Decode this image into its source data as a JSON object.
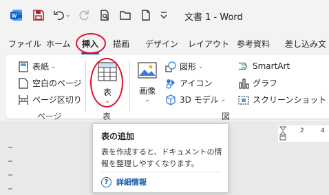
{
  "titlebar": {
    "word_icon_letter": "W",
    "doc_title": "文書 1  -  Word"
  },
  "tabs": [
    {
      "label": "ファイル"
    },
    {
      "label": "ホーム"
    },
    {
      "label": "挿入"
    },
    {
      "label": "描画"
    },
    {
      "label": "デザイン"
    },
    {
      "label": "レイアウト"
    },
    {
      "label": "参考資料"
    },
    {
      "label": "差し込み文"
    }
  ],
  "ribbon": {
    "pages": {
      "cover": "表紙",
      "blank": "空白のページ",
      "break": "ページ区切り",
      "label": "ページ"
    },
    "table": {
      "button": "表",
      "label": "表"
    },
    "illustrations": {
      "image": "画像",
      "shapes": "図形",
      "icons": "アイコン",
      "model3d": "3D モデル",
      "smartart": "SmartArt",
      "chart": "グラフ",
      "screenshot": "スクリーンショット",
      "label": "図"
    }
  },
  "ruler": {
    "n2": "2",
    "n4": "4"
  },
  "tooltip": {
    "title": "表の追加",
    "body": "表を作成すると、ドキュメントの情報を整理しやすくなります。",
    "link": "詳細情報",
    "help_glyph": "?"
  },
  "colors": {
    "accent": "#185abd",
    "annotation": "#e0102b",
    "word": "#185abd",
    "save": "#a4262c"
  }
}
